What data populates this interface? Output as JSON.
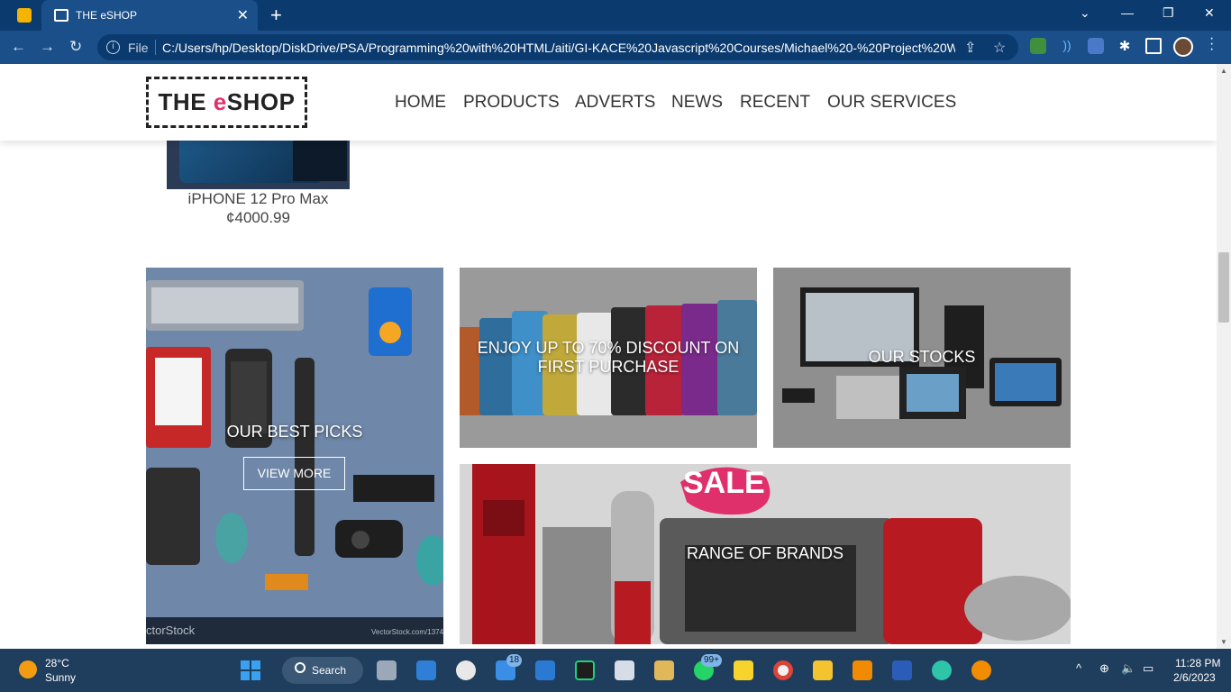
{
  "browser": {
    "tab_title": "THE eSHOP",
    "new_tab_glyph": "+",
    "close_glyph": "✕",
    "file_label": "File",
    "url": "C:/Users/hp/Desktop/DiskDrive/PSA/Programming%20with%20HTML/aiti/GI-KACE%20Javascript%20Courses/Michael%20-%20Project%20W...",
    "back_glyph": "←",
    "forward_glyph": "→",
    "reload_glyph": "↻"
  },
  "site": {
    "logo_prefix": "THE ",
    "logo_e": "e",
    "logo_suffix": "SHOP",
    "nav": [
      "HOME",
      "PRODUCTS",
      "ADVERTS",
      "NEWS",
      "RECENT",
      "OUR SERVICES"
    ]
  },
  "product": {
    "name": "iPHONE 12 Pro Max",
    "price": "¢4000.99"
  },
  "cards": {
    "best_picks": "OUR BEST PICKS",
    "view_more": "VIEW MORE",
    "discount": "ENJOY UP TO 70% DISCOUNT ON FIRST PURCHASE",
    "stocks": "OUR STOCKS",
    "brands": "RANGE OF BRANDS",
    "vectorstock_left": "ctorStock",
    "vectorstock_right": "VectorStock.com/1374",
    "sale_text": "SALE"
  },
  "taskbar": {
    "temp": "28°C",
    "weather": "Sunny",
    "search": "Search",
    "mail_badge": "18",
    "whatsapp_badge": "99+",
    "time": "11:28 PM",
    "date": "2/6/2023"
  },
  "colors": {
    "chrome_dark": "#0b3a6e",
    "chrome_tab": "#1a4f8a",
    "accent_e": "#e0306b",
    "taskbar": "#1f3d5c"
  }
}
